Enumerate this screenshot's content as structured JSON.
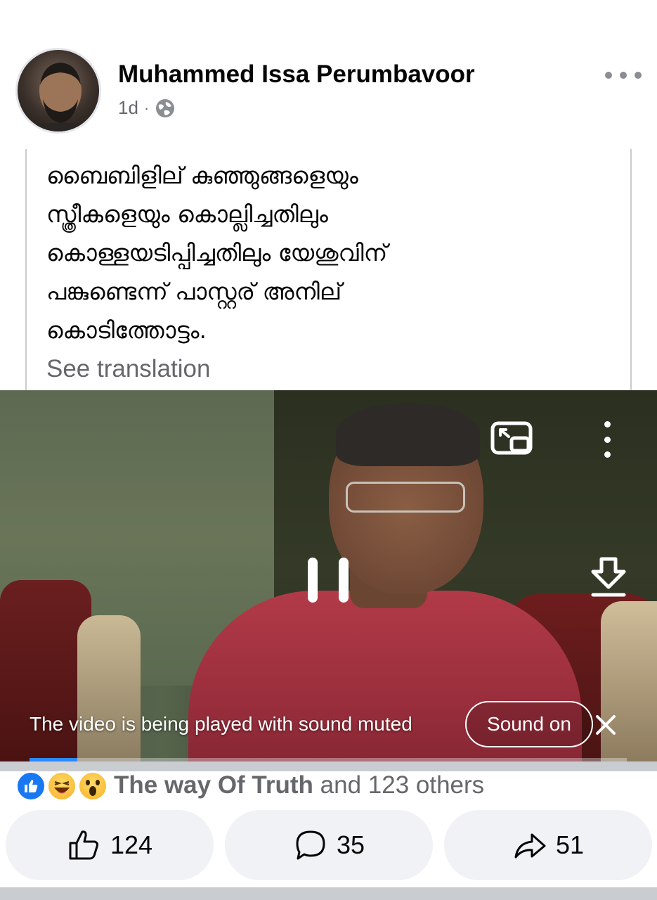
{
  "post": {
    "author": "Muhammed Issa Perumbavoor",
    "time": "1d",
    "separator": "·",
    "privacy_icon": "globe-icon",
    "text_lines": [
      "ബൈബിളില് കുഞ്ഞുങ്ങളെയും",
      "സ്ത്രീകളെയും കൊല്ലിച്ചതിലും",
      "കൊള്ളയടിപ്പിച്ചതിലും യേശുവിന്",
      "പങ്കുണ്ടെന്ന് പാസ്റ്റര് അനില്",
      "കൊടിത്തോട്ടം."
    ],
    "see_translation": "See translation"
  },
  "video": {
    "muted_notice": "The video is being played with sound muted",
    "sound_on_label": "Sound on",
    "progress": 0.08,
    "icons": [
      "picture-in-picture-icon",
      "more-vertical-icon",
      "pause-icon",
      "download-icon",
      "close-icon"
    ]
  },
  "reactions": {
    "types": [
      "like",
      "haha",
      "wow"
    ],
    "lead_name": "The way Of Truth",
    "others_text": "and 123 others"
  },
  "actions": {
    "like_count": "124",
    "comment_count": "35",
    "share_count": "51"
  },
  "colors": {
    "accent": "#1877f2",
    "secondary_text": "#65676b",
    "button_bg": "#f0f2f5"
  }
}
